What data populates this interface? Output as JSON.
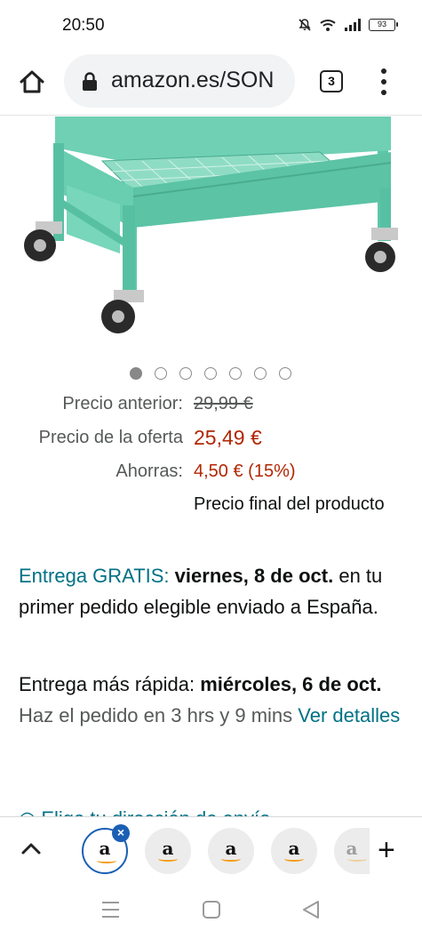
{
  "status": {
    "time": "20:50",
    "battery": "93"
  },
  "browser": {
    "url": "amazon.es/SON",
    "tab_count": "3"
  },
  "carousel": {
    "total": 7,
    "active": 0
  },
  "prices": {
    "previous_label": "Precio anterior:",
    "previous_value": "29,99 €",
    "deal_label": "Precio de la oferta",
    "deal_value": "25,49 €",
    "savings_label": "Ahorras:",
    "savings_value": "4,50 € (15%)",
    "final_note": "Precio final del producto"
  },
  "delivery": {
    "free_label": "Entrega GRATIS:",
    "free_date": "viernes, 8 de oct.",
    "free_condition": "en tu primer pedido elegible enviado a España.",
    "fast_label": "Entrega más rápida:",
    "fast_date": "miércoles, 6 de oct.",
    "order_note": "Haz el pedido en 3 hrs y 9 mins",
    "details_link": "Ver detalles",
    "partial_line": "Elige tu dirección de envío"
  },
  "tabbar": {
    "tab_letter": "a",
    "tabs": [
      "amazon-tab-1",
      "amazon-tab-2",
      "amazon-tab-3",
      "amazon-tab-4",
      "amazon-tab-5"
    ]
  },
  "colors": {
    "link": "#007185",
    "price": "#b12704",
    "tab_active": "#1a5fb4"
  }
}
